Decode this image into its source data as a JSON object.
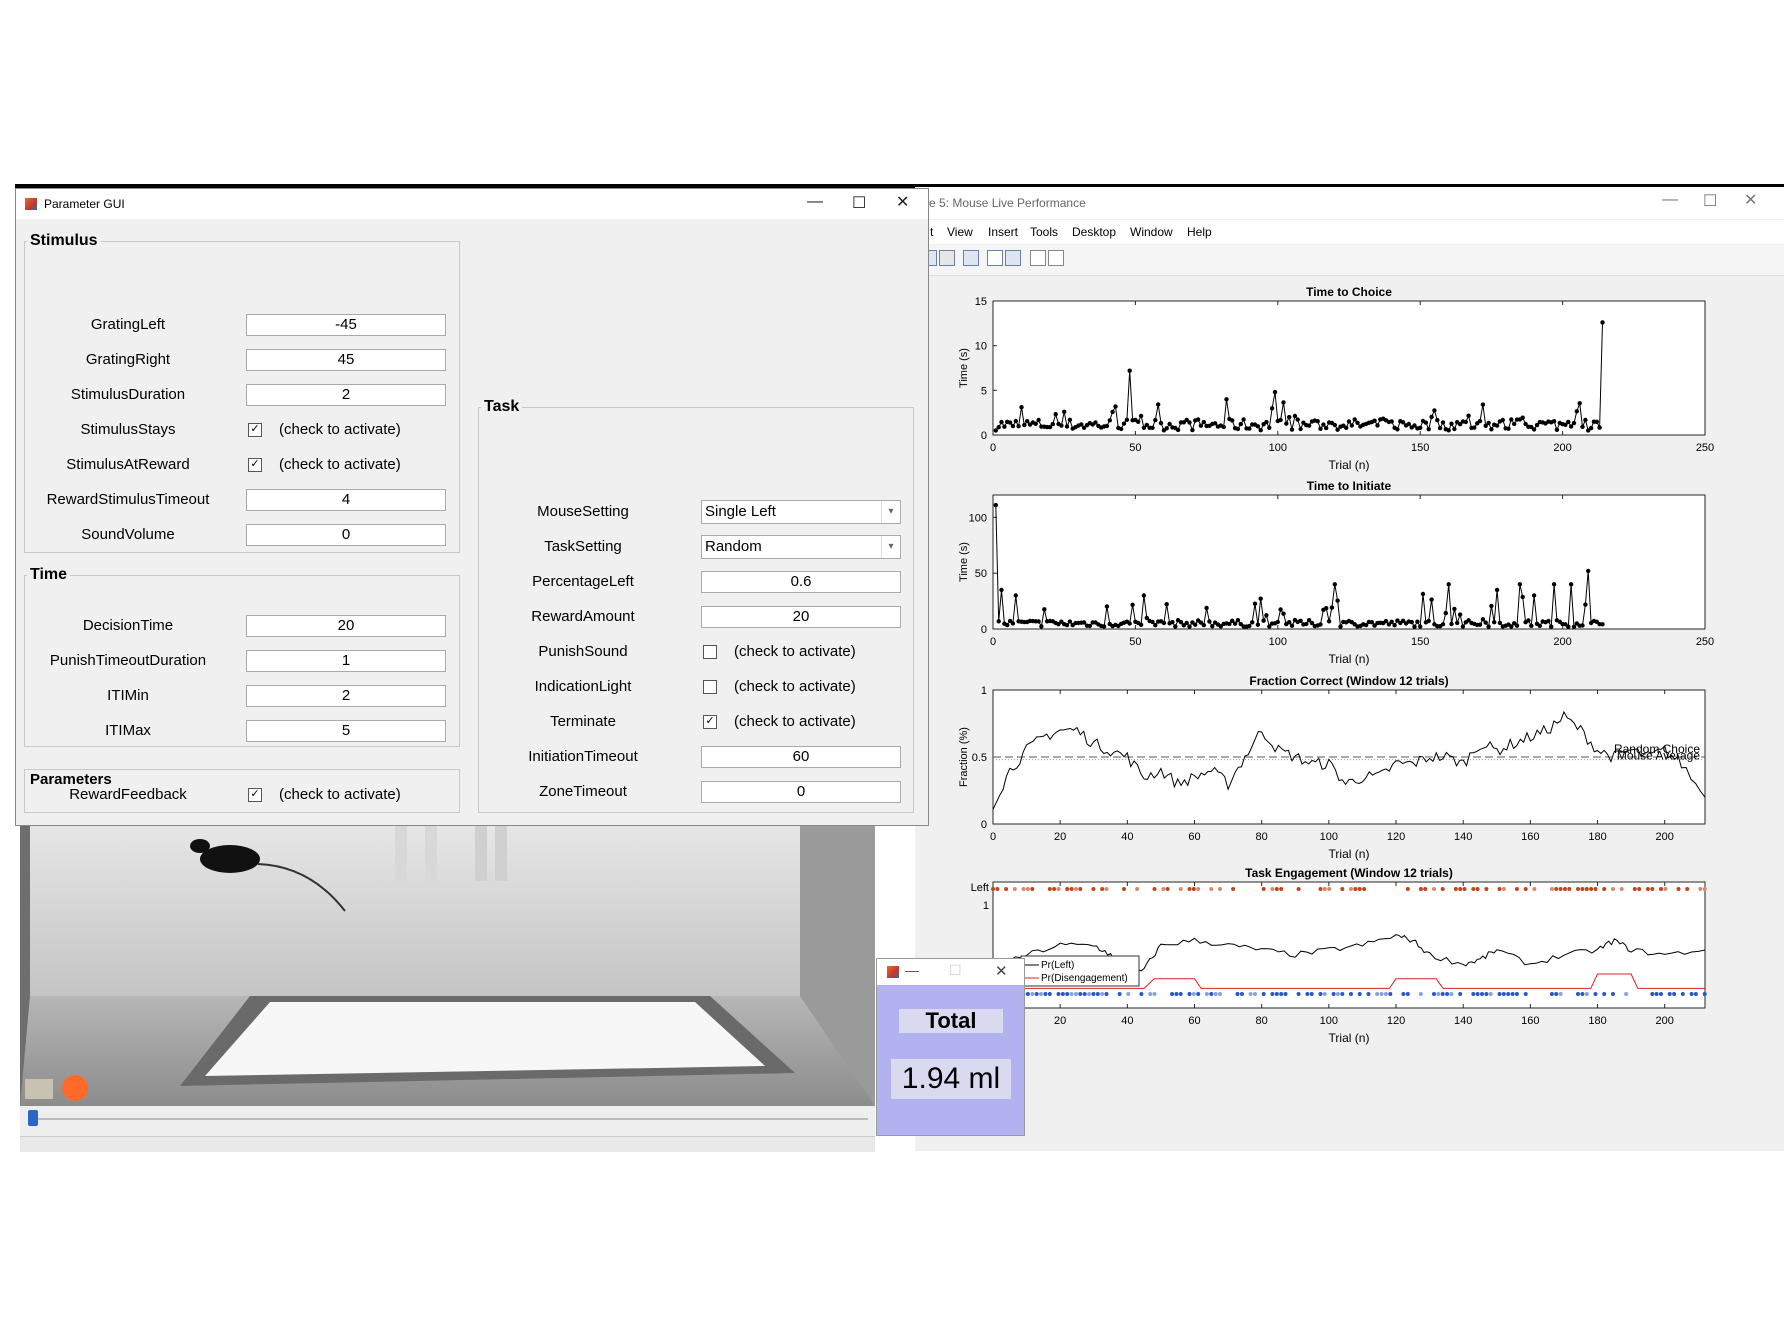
{
  "figure_window": {
    "title": "re 5: Mouse Live Performance",
    "menu": [
      "t",
      "View",
      "Insert",
      "Tools",
      "Desktop",
      "Window",
      "Help"
    ]
  },
  "parameter_gui": {
    "title": "Parameter GUI",
    "stimulus": {
      "title": "Stimulus",
      "grating_left": {
        "label": "GratingLeft",
        "value": "-45"
      },
      "grating_right": {
        "label": "GratingRight",
        "value": "45"
      },
      "stimulus_duration": {
        "label": "StimulusDuration",
        "value": "2"
      },
      "stimulus_stays": {
        "label": "StimulusStays",
        "checked": true,
        "text": "(check to activate)"
      },
      "stimulus_at_reward": {
        "label": "StimulusAtReward",
        "checked": true,
        "text": "(check to activate)"
      },
      "reward_stimulus_timeout": {
        "label": "RewardStimulusTimeout",
        "value": "4"
      },
      "sound_volume": {
        "label": "SoundVolume",
        "value": "0"
      }
    },
    "time": {
      "title": "Time",
      "decision_time": {
        "label": "DecisionTime",
        "value": "20"
      },
      "punish_timeout_duration": {
        "label": "PunishTimeoutDuration",
        "value": "1"
      },
      "iti_min": {
        "label": "ITIMin",
        "value": "2"
      },
      "iti_max": {
        "label": "ITIMax",
        "value": "5"
      }
    },
    "parameters": {
      "title": "Parameters",
      "reward_feedback": {
        "label": "RewardFeedback",
        "checked": true,
        "text": "(check to activate)"
      }
    },
    "task": {
      "title": "Task",
      "mouse_setting": {
        "label": "MouseSetting",
        "value": "Single Left"
      },
      "task_setting": {
        "label": "TaskSetting",
        "value": "Random"
      },
      "percentage_left": {
        "label": "PercentageLeft",
        "value": "0.6"
      },
      "reward_amount": {
        "label": "RewardAmount",
        "value": "20"
      },
      "punish_sound": {
        "label": "PunishSound",
        "checked": false,
        "text": "(check to activate)"
      },
      "indication_light": {
        "label": "IndicationLight",
        "checked": false,
        "text": "(check to activate)"
      },
      "terminate": {
        "label": "Terminate",
        "checked": true,
        "text": "(check to activate)"
      },
      "initiation_timeout": {
        "label": "InitiationTimeout",
        "value": "60"
      },
      "zone_timeout": {
        "label": "ZoneTimeout",
        "value": "0"
      }
    }
  },
  "total_window": {
    "minimize": "—",
    "label": "Total",
    "value": "1.94 ml"
  },
  "chart_data": [
    {
      "type": "line",
      "title": "Time to Choice",
      "xlabel": "Trial (n)",
      "ylabel": "Time (s)",
      "xlim": [
        0,
        250
      ],
      "ylim": [
        0,
        15
      ],
      "xticks": [
        0,
        50,
        100,
        150,
        200,
        250
      ],
      "yticks": [
        0,
        5,
        10,
        15
      ],
      "spikes": [
        [
          7,
          1.0
        ],
        [
          48,
          7.2
        ],
        [
          82,
          4.0
        ],
        [
          99,
          4.8
        ],
        [
          214,
          12.6
        ]
      ],
      "n_trials": 214,
      "baseline": 1.0
    },
    {
      "type": "line",
      "title": "Time to Initiate",
      "xlabel": "Trial (n)",
      "ylabel": "Time (s)",
      "xlim": [
        0,
        250
      ],
      "ylim": [
        0,
        120
      ],
      "xticks": [
        0,
        50,
        100,
        150,
        200,
        250
      ],
      "yticks": [
        0,
        50,
        100
      ],
      "spikes": [
        [
          1,
          111
        ],
        [
          3,
          35
        ],
        [
          8,
          30
        ],
        [
          53,
          30
        ],
        [
          120,
          40
        ],
        [
          160,
          40
        ],
        [
          177,
          35
        ],
        [
          185,
          40
        ],
        [
          190,
          30
        ],
        [
          197,
          40
        ],
        [
          203,
          40
        ],
        [
          209,
          52
        ]
      ],
      "n_trials": 214
    },
    {
      "type": "line",
      "title": "Fraction Correct (Window 12 trials)",
      "xlabel": "Trial (n)",
      "ylabel": "Fraction (%)",
      "xlim": [
        0,
        212
      ],
      "ylim": [
        0,
        1
      ],
      "xticks": [
        0,
        20,
        40,
        60,
        80,
        100,
        120,
        140,
        160,
        180,
        200
      ],
      "yticks": [
        0,
        0.5,
        1
      ],
      "annotations": [
        "Random Choice",
        "Mouse Average"
      ],
      "points": [
        [
          0,
          0.15
        ],
        [
          5,
          0.4
        ],
        [
          10,
          0.55
        ],
        [
          15,
          0.65
        ],
        [
          20,
          0.7
        ],
        [
          25,
          0.7
        ],
        [
          30,
          0.6
        ],
        [
          35,
          0.55
        ],
        [
          40,
          0.5
        ],
        [
          45,
          0.35
        ],
        [
          50,
          0.4
        ],
        [
          55,
          0.3
        ],
        [
          60,
          0.35
        ],
        [
          65,
          0.4
        ],
        [
          70,
          0.3
        ],
        [
          75,
          0.5
        ],
        [
          80,
          0.7
        ],
        [
          85,
          0.55
        ],
        [
          90,
          0.5
        ],
        [
          95,
          0.45
        ],
        [
          100,
          0.45
        ],
        [
          105,
          0.3
        ],
        [
          110,
          0.35
        ],
        [
          115,
          0.35
        ],
        [
          120,
          0.45
        ],
        [
          125,
          0.45
        ],
        [
          130,
          0.5
        ],
        [
          135,
          0.5
        ],
        [
          140,
          0.45
        ],
        [
          145,
          0.6
        ],
        [
          150,
          0.55
        ],
        [
          155,
          0.6
        ],
        [
          160,
          0.65
        ],
        [
          165,
          0.7
        ],
        [
          170,
          0.8
        ],
        [
          175,
          0.7
        ],
        [
          180,
          0.55
        ],
        [
          185,
          0.5
        ],
        [
          190,
          0.55
        ],
        [
          195,
          0.5
        ],
        [
          200,
          0.55
        ],
        [
          205,
          0.45
        ],
        [
          212,
          0.2
        ]
      ]
    },
    {
      "type": "line",
      "title": "Task Engagement (Window 12 trials)",
      "xlabel": "Trial (n)",
      "xlim": [
        0,
        212
      ],
      "ylim": [
        0,
        1.2
      ],
      "xticks": [
        20,
        40,
        60,
        80,
        100,
        120,
        140,
        160,
        180,
        200
      ],
      "ytick_labels": [
        "Left",
        "1"
      ],
      "series": [
        {
          "name": "Pr(Left)",
          "color": "#000000",
          "points": [
            [
              0,
              0.3
            ],
            [
              10,
              0.45
            ],
            [
              20,
              0.55
            ],
            [
              30,
              0.55
            ],
            [
              35,
              0.45
            ],
            [
              40,
              0.2
            ],
            [
              45,
              0.3
            ],
            [
              50,
              0.55
            ],
            [
              60,
              0.6
            ],
            [
              70,
              0.55
            ],
            [
              80,
              0.5
            ],
            [
              90,
              0.45
            ],
            [
              100,
              0.5
            ],
            [
              110,
              0.55
            ],
            [
              120,
              0.65
            ],
            [
              125,
              0.6
            ],
            [
              130,
              0.45
            ],
            [
              140,
              0.35
            ],
            [
              145,
              0.4
            ],
            [
              150,
              0.5
            ],
            [
              160,
              0.35
            ],
            [
              170,
              0.45
            ],
            [
              180,
              0.5
            ],
            [
              185,
              0.6
            ],
            [
              190,
              0.5
            ],
            [
              200,
              0.45
            ],
            [
              212,
              0.5
            ]
          ]
        },
        {
          "name": "Pr(Disengagement)",
          "color": "#e02020",
          "points": [
            [
              0,
              0.1
            ],
            [
              45,
              0.1
            ],
            [
              48,
              0.2
            ],
            [
              60,
              0.2
            ],
            [
              62,
              0.1
            ],
            [
              118,
              0.1
            ],
            [
              120,
              0.2
            ],
            [
              132,
              0.2
            ],
            [
              134,
              0.1
            ],
            [
              178,
              0.1
            ],
            [
              180,
              0.25
            ],
            [
              190,
              0.25
            ],
            [
              192,
              0.1
            ],
            [
              212,
              0.1
            ]
          ]
        }
      ]
    }
  ]
}
